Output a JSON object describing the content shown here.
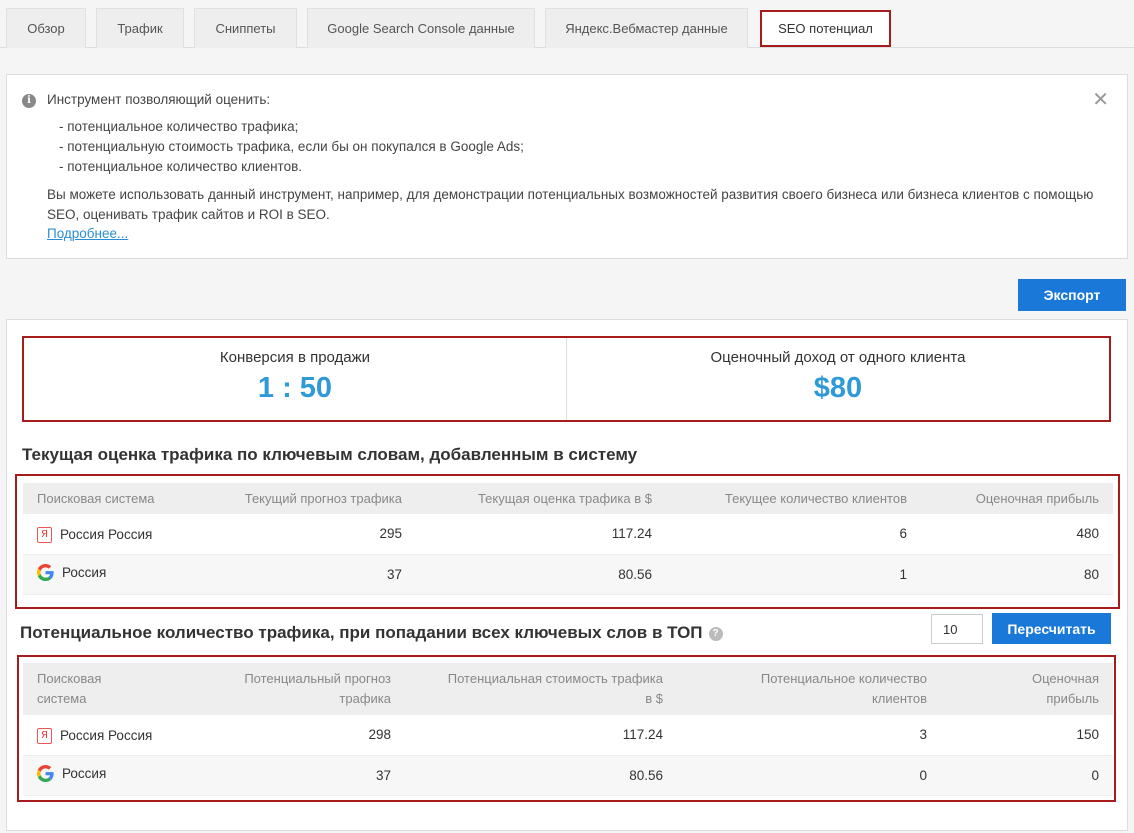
{
  "tabs": [
    {
      "label": "Обзор"
    },
    {
      "label": "Трафик"
    },
    {
      "label": "Сниппеты"
    },
    {
      "label": "Google Search Console данные"
    },
    {
      "label": "Яндекс.Вебмастер данные"
    },
    {
      "label": "SEO потенциал",
      "active": true
    }
  ],
  "info": {
    "title": "Инструмент позволяющий оценить:",
    "items": [
      "- потенциальное количество трафика;",
      "- потенциальную стоимость трафика, если бы он покупался в Google Ads;",
      "- потенциальное количество клиентов."
    ],
    "description": "Вы можете использовать данный инструмент, например, для демонстрации потенциальных возможностей развития своего бизнеса или бизнеса клиентов с помощью SEO, оценивать трафик сайтов и ROI в SEO.",
    "link": "Подробнее..."
  },
  "export_label": "Экспорт",
  "kpi": {
    "conversion_label": "Конверсия в продажи",
    "conversion_value": "1 : 50",
    "income_label": "Оценочный доход от одного клиента",
    "income_value": "$80"
  },
  "current": {
    "title": "Текущая оценка трафика по ключевым словам, добавленным в систему",
    "headers": [
      "Поисковая система",
      "Текущий прогноз трафика",
      "Текущая оценка трафика в $",
      "Текущее количество клиентов",
      "Оценочная прибыль"
    ],
    "rows": [
      {
        "engine": "yandex",
        "engine_icon": "yandex-icon",
        "engine_label": "Я",
        "region": "Россия Россия",
        "traffic": "295",
        "cost": "117.24",
        "clients": "6",
        "profit": "480"
      },
      {
        "engine": "google",
        "engine_icon": "google-icon",
        "region": "Россия",
        "traffic": "37",
        "cost": "80.56",
        "clients": "1",
        "profit": "80"
      }
    ]
  },
  "potential": {
    "title": "Потенциальное количество трафика, при попадании всех ключевых слов в ТОП",
    "top_input": "10",
    "recalc_label": "Пересчитать",
    "headers": [
      "Поисковая система",
      "Потенциальный прогноз трафика",
      "Потенциальная стоимость трафика в $",
      "Потенциальное количество клиентов",
      "Оценочная прибыль"
    ],
    "rows": [
      {
        "engine": "yandex",
        "engine_icon": "yandex-icon",
        "engine_label": "Я",
        "region": "Россия Россия",
        "traffic": "298",
        "cost": "117.24",
        "clients": "3",
        "profit": "150"
      },
      {
        "engine": "google",
        "engine_icon": "google-icon",
        "region": "Россия",
        "traffic": "37",
        "cost": "80.56",
        "clients": "0",
        "profit": "0"
      }
    ]
  }
}
